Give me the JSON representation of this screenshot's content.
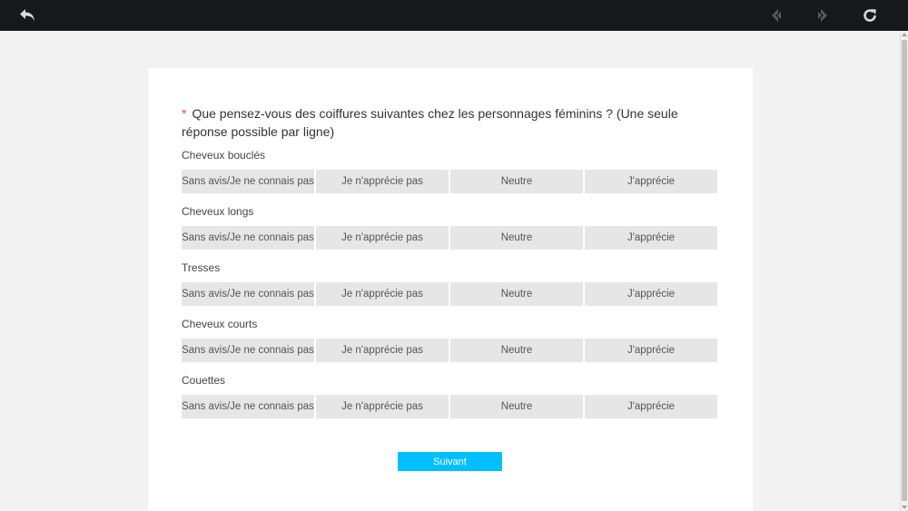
{
  "toolbar": {
    "back_icon": "undo-arrow-icon",
    "prev_icon": "chevron-left-icon",
    "next_icon": "chevron-right-icon",
    "reload_icon": "reload-icon"
  },
  "survey": {
    "required_marker": "*",
    "question": "Que pensez-vous des coiffures suivantes chez les personnages féminins ?  (Une seule réponse possible par ligne)",
    "options": [
      "Sans avis/Je ne connais pas",
      "Je n'apprécie pas",
      "Neutre",
      "J'apprécie"
    ],
    "rows": [
      {
        "label": "Cheveux bouclés"
      },
      {
        "label": "Cheveux longs"
      },
      {
        "label": "Tresses"
      },
      {
        "label": "Cheveux courts"
      },
      {
        "label": "Couettes"
      }
    ],
    "next_label": "Suivant"
  },
  "colors": {
    "topbar": "#17181a",
    "page_bg": "#f2f2f2",
    "option_bg": "#e6e6e6",
    "accent": "#00bfff",
    "required": "#e74c3c"
  }
}
